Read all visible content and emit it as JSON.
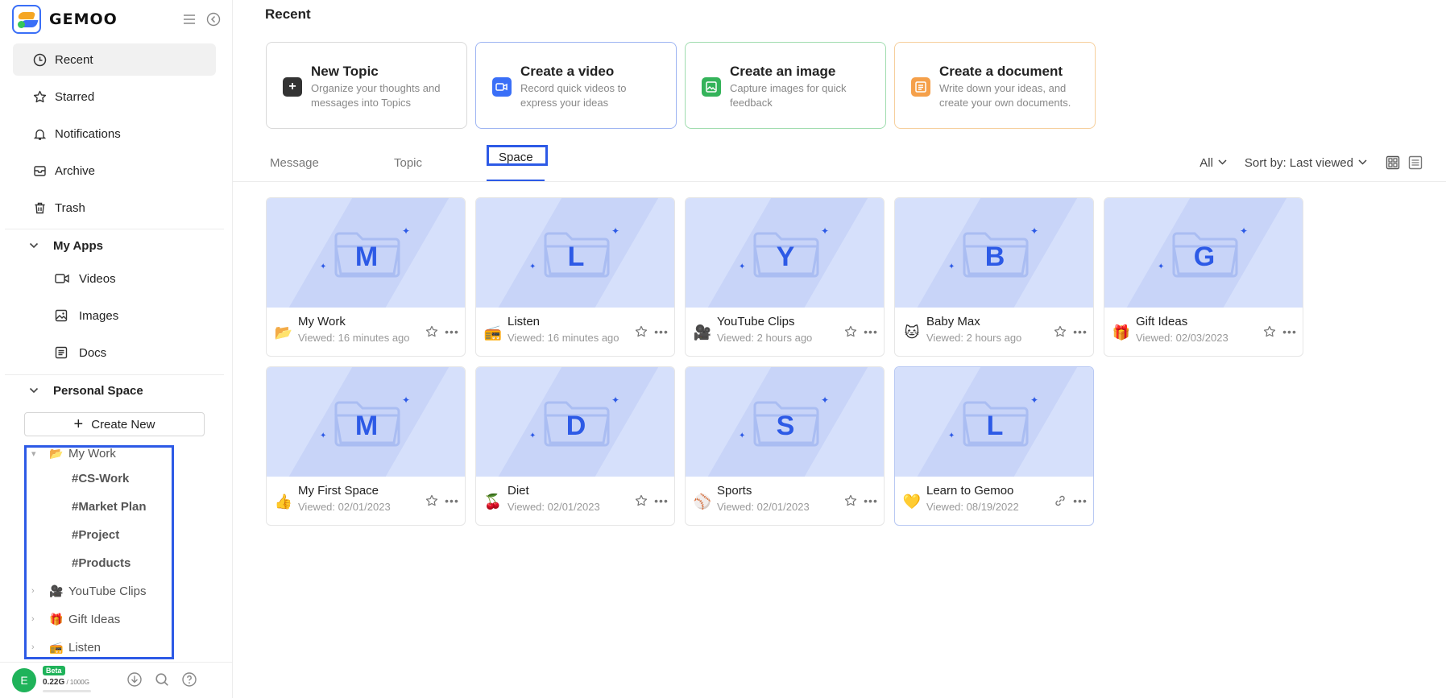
{
  "app": {
    "logo_text": "GEMOO"
  },
  "sidebar": {
    "nav": [
      {
        "label": "Recent",
        "icon": "clock-icon"
      },
      {
        "label": "Starred",
        "icon": "star-icon"
      },
      {
        "label": "Notifications",
        "icon": "bell-icon"
      },
      {
        "label": "Archive",
        "icon": "archive-icon"
      },
      {
        "label": "Trash",
        "icon": "trash-icon"
      }
    ],
    "my_apps": {
      "label": "My Apps",
      "items": [
        {
          "label": "Videos",
          "icon": "video-icon"
        },
        {
          "label": "Images",
          "icon": "image-icon"
        },
        {
          "label": "Docs",
          "icon": "doc-icon"
        }
      ]
    },
    "personal_space": {
      "label": "Personal Space",
      "create_new": "Create New",
      "tree": [
        {
          "label": "My Work",
          "icon": "folder-icon"
        },
        {
          "label": "#CS-Work"
        },
        {
          "label": "#Market Plan"
        },
        {
          "label": "#Project"
        },
        {
          "label": "#Products"
        },
        {
          "label": "YouTube Clips",
          "icon": "film-camera-icon"
        },
        {
          "label": "Gift Ideas",
          "icon": "gift-icon"
        },
        {
          "label": "Listen",
          "icon": "radio-icon"
        }
      ]
    },
    "footer": {
      "avatar_letter": "E",
      "beta": "Beta",
      "quota_used": "0.22G",
      "quota_total": " / 1000G"
    }
  },
  "main": {
    "title": "Recent",
    "create_cards": [
      {
        "title": "New Topic",
        "desc": "Organize your thoughts and messages into Topics",
        "icon": "plus-icon",
        "border": "#d9d9d9",
        "icon_bg": "#333333"
      },
      {
        "title": "Create a video",
        "desc": "Record quick videos to express your ideas",
        "icon": "video-camera-icon",
        "border": "#9db4f2",
        "icon_bg": "#3a6ff7"
      },
      {
        "title": "Create an image",
        "desc": "Capture images for quick feedback",
        "icon": "image-icon",
        "border": "#9fdcae",
        "icon_bg": "#34b35a"
      },
      {
        "title": "Create a document",
        "desc": "Write down your ideas, and create your own documents.",
        "icon": "doc-icon",
        "border": "#f6cf9c",
        "icon_bg": "#f5a04a"
      }
    ],
    "tabs": [
      {
        "label": "Message"
      },
      {
        "label": "Topic"
      },
      {
        "label": "Space"
      }
    ],
    "filter_all": "All",
    "sort_label": "Sort by: Last viewed",
    "spaces": [
      {
        "letter": "M",
        "name": "My Work",
        "viewed": "Viewed: 16 minutes ago",
        "icon": "folder-icon"
      },
      {
        "letter": "L",
        "name": "Listen",
        "viewed": "Viewed: 16 minutes ago",
        "icon": "radio-icon"
      },
      {
        "letter": "Y",
        "name": "YouTube Clips",
        "viewed": "Viewed: 2 hours ago",
        "icon": "film-camera-icon"
      },
      {
        "letter": "B",
        "name": "Baby Max",
        "viewed": "Viewed: 2 hours ago",
        "icon": "cat-face-icon"
      },
      {
        "letter": "G",
        "name": "Gift Ideas",
        "viewed": "Viewed: 02/03/2023",
        "icon": "gift-icon"
      },
      {
        "letter": "M",
        "name": "My First Space",
        "viewed": "Viewed: 02/01/2023",
        "icon": "thumbs-up-icon"
      },
      {
        "letter": "D",
        "name": "Diet",
        "viewed": "Viewed: 02/01/2023",
        "icon": "cherries-icon"
      },
      {
        "letter": "S",
        "name": "Sports",
        "viewed": "Viewed: 02/01/2023",
        "icon": "baseball-icon"
      },
      {
        "letter": "L",
        "name": "Learn to Gemoo",
        "viewed": "Viewed: 08/19/2022",
        "icon": "hearts-icon"
      }
    ]
  }
}
